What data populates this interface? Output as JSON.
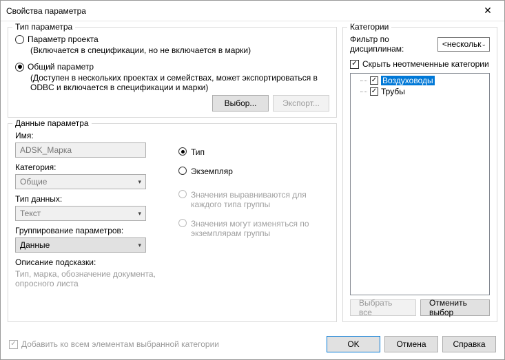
{
  "window": {
    "title": "Свойства параметра"
  },
  "param_type": {
    "legend": "Тип параметра",
    "project_param": "Параметр проекта",
    "project_hint": "(Включается в спецификации, но не включается в марки)",
    "shared_param": "Общий параметр",
    "shared_hint": "(Доступен в нескольких проектах и семействах, может экспортироваться в ODBC и включается в спецификации и марки)",
    "choose_btn": "Выбор...",
    "export_btn": "Экспорт..."
  },
  "param_data": {
    "legend": "Данные параметра",
    "name_label": "Имя:",
    "name_value": "ADSK_Марка",
    "category_label": "Категория:",
    "category_value": "Общие",
    "datatype_label": "Тип данных:",
    "datatype_value": "Текст",
    "grouping_label": "Группирование параметров:",
    "grouping_value": "Данные",
    "tooltip_label": "Описание подсказки:",
    "tooltip_hint": "Тип, марка, обозначение документа, опросного листа",
    "type_radio": "Тип",
    "instance_radio": "Экземпляр",
    "align_group": "Значения выравниваются для каждого типа группы",
    "vary_group": "Значения могут изменяться по экземплярам группы"
  },
  "categories": {
    "legend": "Категории",
    "filter_label": "Фильтр по дисциплинам:",
    "filter_value": "<нескольк",
    "hide_unchecked": "Скрыть неотмеченные категории",
    "items": [
      {
        "label": "Воздуховоды",
        "checked": true,
        "selected": true
      },
      {
        "label": "Трубы",
        "checked": true,
        "selected": false
      }
    ],
    "select_all": "Выбрать все",
    "deselect_all": "Отменить выбор"
  },
  "footer": {
    "add_all": "Добавить ко всем элементам выбранной категории",
    "ok": "OK",
    "cancel": "Отмена",
    "help": "Справка"
  }
}
